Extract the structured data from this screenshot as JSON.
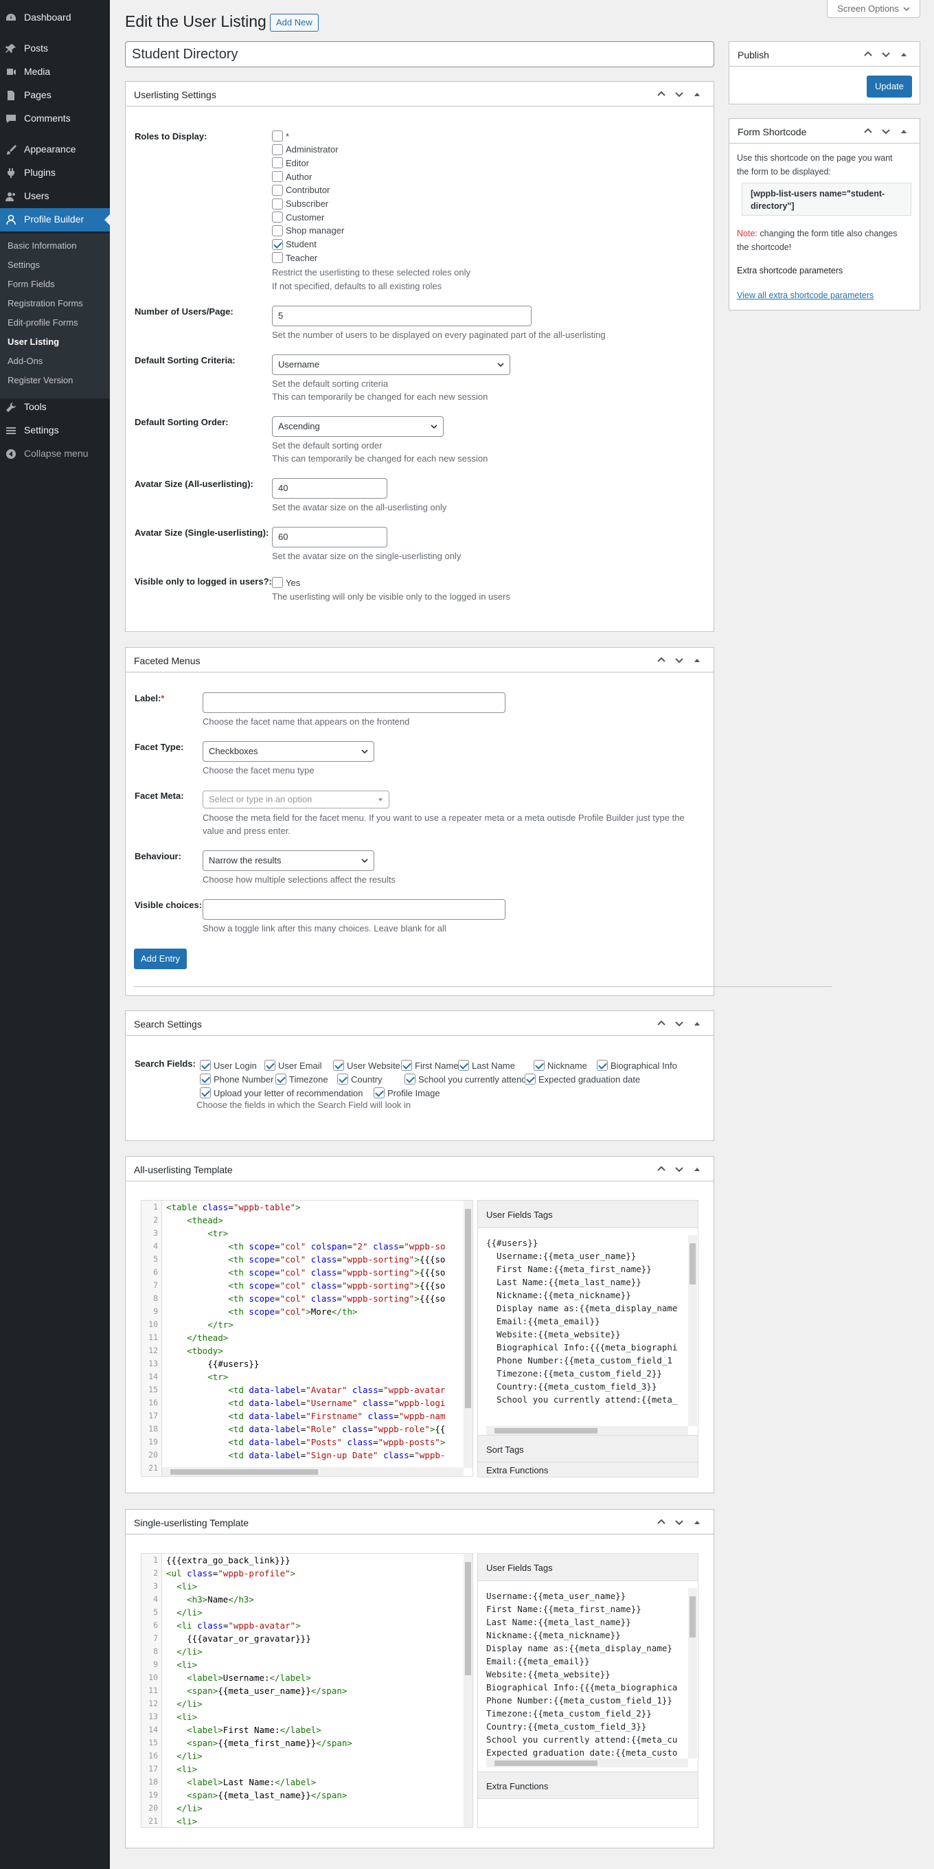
{
  "sidebar": {
    "menu": [
      {
        "label": "Dashboard",
        "icon": "dashboard-icon"
      },
      {
        "label": "Posts",
        "icon": "pin-icon"
      },
      {
        "label": "Media",
        "icon": "media-icon"
      },
      {
        "label": "Pages",
        "icon": "pages-icon"
      },
      {
        "label": "Comments",
        "icon": "comments-icon"
      },
      {
        "label": "Appearance",
        "icon": "brush-icon"
      },
      {
        "label": "Plugins",
        "icon": "plug-icon"
      },
      {
        "label": "Users",
        "icon": "users-icon"
      },
      {
        "label": "Profile Builder",
        "icon": "user-icon"
      },
      {
        "label": "Tools",
        "icon": "wrench-icon"
      },
      {
        "label": "Settings",
        "icon": "settings-icon"
      },
      {
        "label": "Collapse menu",
        "icon": "collapse-icon"
      }
    ],
    "submenu": [
      "Basic Information",
      "Settings",
      "Form Fields",
      "Registration Forms",
      "Edit-profile Forms",
      "User Listing",
      "Add-Ons",
      "Register Version"
    ]
  },
  "screen_options": "Screen Options",
  "page": {
    "title": "Edit the User Listing",
    "add_new": "Add New",
    "listing_title": "Student Directory"
  },
  "userlisting": {
    "title": "Userlisting Settings",
    "roles_label": "Roles to Display:",
    "roles": [
      {
        "label": "*",
        "checked": false
      },
      {
        "label": "Administrator",
        "checked": false
      },
      {
        "label": "Editor",
        "checked": false
      },
      {
        "label": "Author",
        "checked": false
      },
      {
        "label": "Contributor",
        "checked": false
      },
      {
        "label": "Subscriber",
        "checked": false
      },
      {
        "label": "Customer",
        "checked": false
      },
      {
        "label": "Shop manager",
        "checked": false
      },
      {
        "label": "Student",
        "checked": true
      },
      {
        "label": "Teacher",
        "checked": false
      }
    ],
    "roles_desc1": "Restrict the userlisting to these selected roles only",
    "roles_desc2": "If not specified, defaults to all existing roles",
    "num_label": "Number of Users/Page:",
    "num_value": "5",
    "num_desc": "Set the number of users to be displayed on every paginated part of the all-userlisting",
    "sort_label": "Default Sorting Criteria:",
    "sort_value": "Username",
    "sort_desc1": "Set the default sorting criteria",
    "sort_desc2": "This can temporarily be changed for each new session",
    "order_label": "Default Sorting Order:",
    "order_value": "Ascending",
    "order_desc1": "Set the default sorting order",
    "order_desc2": "This can temporarily be changed for each new session",
    "avatar_all_label": "Avatar Size (All-userlisting):",
    "avatar_all_value": "40",
    "avatar_all_desc": "Set the avatar size on the all-userlisting only",
    "avatar_single_label": "Avatar Size (Single-userlisting):",
    "avatar_single_value": "60",
    "avatar_single_desc": "Set the avatar size on the single-userlisting only",
    "visible_label": "Visible only to logged in users?:",
    "visible_option": "Yes",
    "visible_desc": "The userlisting will only be visible only to the logged in users"
  },
  "faceted": {
    "title": "Faceted Menus",
    "label_label": "Label:",
    "required_star": "*",
    "label_desc": "Choose the facet name that appears on the frontend",
    "type_label": "Facet Type:",
    "type_value": "Checkboxes",
    "type_desc": "Choose the facet menu type",
    "meta_label": "Facet Meta:",
    "meta_placeholder": "Select or type in an option",
    "meta_desc1": "Choose the meta field for the facet menu. If you want to use a repeater meta or a meta outisde Profile Builder just type the",
    "meta_desc2": "value and press enter.",
    "behaviour_label": "Behaviour:",
    "behaviour_value": "Narrow the results",
    "behaviour_desc": "Choose how multiple selections affect the results",
    "visible_label": "Visible choices:",
    "visible_desc": "Show a toggle link after this many choices. Leave blank for all",
    "add_entry": "Add Entry"
  },
  "search": {
    "title": "Search Settings",
    "fields_label": "Search Fields:",
    "fields": [
      "User Login",
      "User Email",
      "User Website",
      "First Name",
      "Last Name",
      "Nickname",
      "Biographical Info",
      "Phone Number",
      "Timezone",
      "Country",
      "School you currently attend",
      "Expected graduation date",
      "Upload your letter of recommendation",
      "Profile Image"
    ],
    "desc": "Choose the fields in which the Search Field will look in"
  },
  "all_template": {
    "title": "All-userlisting Template",
    "line_numbers": [
      "1",
      "2",
      "3",
      "4",
      "5",
      "6",
      "7",
      "8",
      "9",
      "10",
      "11",
      "12",
      "13",
      "14",
      "15",
      "16",
      "17",
      "18",
      "19",
      "20",
      "21"
    ],
    "tags_title": "User Fields Tags",
    "tags": [
      "{{#users}}",
      "  Username:{{meta_user_name}}",
      "  First Name:{{meta_first_name}}",
      "  Last Name:{{meta_last_name}}",
      "  Nickname:{{meta_nickname}}",
      "  Display name as:{{meta_display_name",
      "  Email:{{meta_email}}",
      "  Website:{{meta_website}}",
      "  Biographical Info:{{{meta_biographi",
      "  Phone Number:{{meta_custom_field_1",
      "  Timezone:{{meta_custom_field_2}}",
      "  Country:{{meta_custom_field_3}}",
      "  School you currently attend:{{meta_"
    ],
    "sort_tags": "Sort Tags",
    "extra_functions": "Extra Functions"
  },
  "single_template": {
    "title": "Single-userlisting Template",
    "line_numbers": [
      "1",
      "2",
      "3",
      "4",
      "5",
      "6",
      "7",
      "8",
      "9",
      "10",
      "11",
      "12",
      "13",
      "14",
      "15",
      "16",
      "17",
      "18",
      "19",
      "20",
      "21"
    ],
    "tags_title": "User Fields Tags",
    "tags": [
      "Username:{{meta_user_name}}",
      "First Name:{{meta_first_name}}",
      "Last Name:{{meta_last_name}}",
      "Nickname:{{meta_nickname}}",
      "Display name as:{{meta_display_name}",
      "Email:{{meta_email}}",
      "Website:{{meta_website}}",
      "Biographical Info:{{{meta_biographica",
      "Phone Number:{{meta_custom_field_1}}",
      "Timezone:{{meta_custom_field_2}}",
      "Country:{{meta_custom_field_3}}",
      "School you currently attend:{{meta_cu",
      "Expected graduation date:{{meta_custo"
    ],
    "extra_functions": "Extra Functions"
  },
  "publish": {
    "title": "Publish",
    "update": "Update"
  },
  "shortcode": {
    "title": "Form Shortcode",
    "desc1": "Use this shortcode on the page you want",
    "desc2": "the form to be displayed:",
    "code1": "[wppb-list-users name=\"student-",
    "code2": "directory\"]",
    "note_label": "Note:",
    "note1": " changing the form title also changes",
    "note2": "the shortcode!",
    "extra_label": "Extra shortcode parameters",
    "extra_link": "View all extra shortcode parameters"
  },
  "colors": {
    "accent": "#2271b1",
    "sidebar": "#1d2327",
    "note": "#d63638"
  }
}
